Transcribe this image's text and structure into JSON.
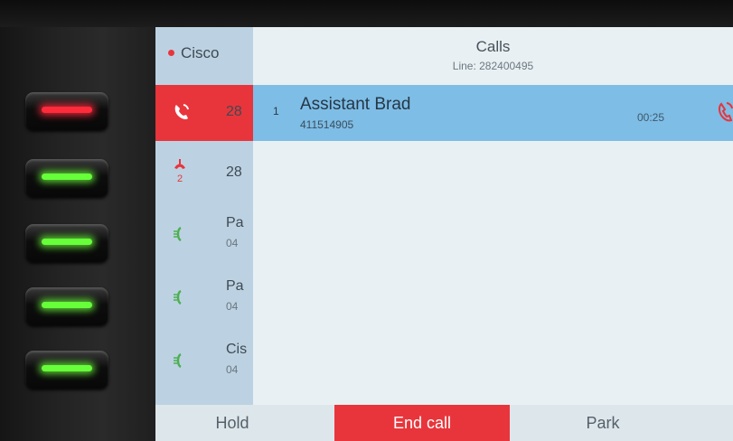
{
  "line_keys": [
    {
      "led": "red",
      "color": "#ff2b3a"
    },
    {
      "led": "green",
      "color": "#67ff3a"
    },
    {
      "led": "green",
      "color": "#67ff3a"
    },
    {
      "led": "green",
      "color": "#67ff3a"
    },
    {
      "led": "green",
      "color": "#67ff3a"
    }
  ],
  "left_panel": {
    "title": "Cisco",
    "rows": [
      {
        "icon": "active-call-icon",
        "text": "28",
        "active": true
      },
      {
        "icon": "hold-two-icon",
        "text": "28"
      },
      {
        "icon": "phone-icon",
        "text": "Pa",
        "sub": "04"
      },
      {
        "icon": "phone-icon",
        "text": "Pa",
        "sub": "04"
      },
      {
        "icon": "phone-icon",
        "text": "Cis",
        "sub": "04"
      }
    ]
  },
  "calls": {
    "title": "Calls",
    "line": "Line: 282400495",
    "items": [
      {
        "index": "1",
        "name": "Assistant Brad",
        "number": "411514905",
        "timer": "00:25",
        "icon": "active-call-icon"
      }
    ]
  },
  "softkeys": {
    "hold": "Hold",
    "end_call": "End call",
    "park": "Park"
  },
  "colors": {
    "accent_red": "#e8353c",
    "selected_row": "#7ebde6",
    "panel": "#bcd2e2"
  }
}
